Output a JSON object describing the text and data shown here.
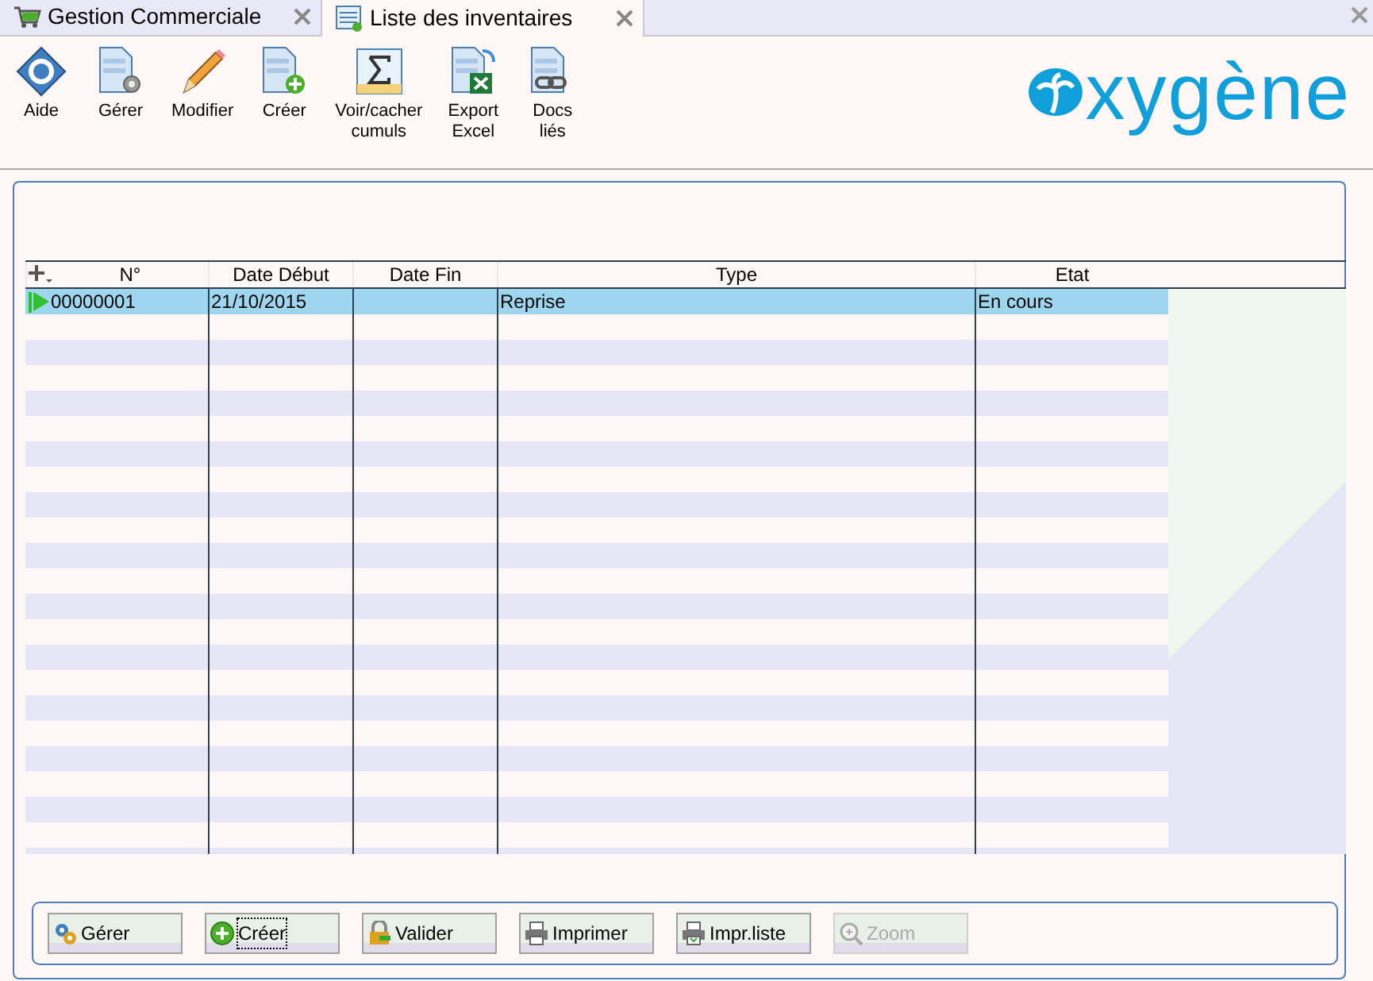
{
  "tabs": [
    {
      "label": "Gestion Commerciale",
      "selected": false
    },
    {
      "label": "Liste des inventaires",
      "selected": true
    }
  ],
  "toolbar": [
    {
      "label": "Aide"
    },
    {
      "label": "Gérer"
    },
    {
      "label": "Modifier"
    },
    {
      "label": "Créer"
    },
    {
      "label": "Voir/cacher cumuls"
    },
    {
      "label": "Export Excel"
    },
    {
      "label": "Docs liés"
    }
  ],
  "logo": "xygène",
  "table": {
    "columns": [
      "N°",
      "Date Début",
      "Date Fin",
      "Type",
      "Etat"
    ],
    "rows": [
      {
        "cells": [
          "00000001",
          "21/10/2015",
          "",
          "Reprise",
          "En cours"
        ],
        "selected": true
      }
    ]
  },
  "actions": [
    {
      "label": "Gérer",
      "disabled": false,
      "focused": false
    },
    {
      "label": "Créer",
      "disabled": false,
      "focused": true
    },
    {
      "label": "Valider",
      "disabled": false,
      "focused": false
    },
    {
      "label": "Imprimer",
      "disabled": false,
      "focused": false
    },
    {
      "label": "Impr.liste",
      "disabled": false,
      "focused": false
    },
    {
      "label": "Zoom",
      "disabled": true,
      "focused": false
    }
  ]
}
